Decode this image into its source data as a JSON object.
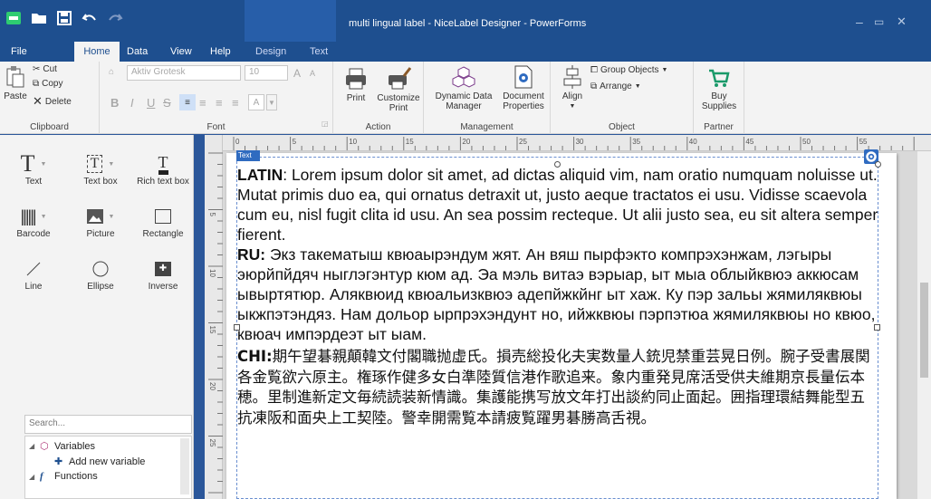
{
  "window": {
    "title": "multi lingual label - NiceLabel Designer - PowerForms",
    "min_symbol": "–",
    "max_symbol": "▭",
    "close_symbol": "✕"
  },
  "tabs": {
    "file": "File",
    "home": "Home",
    "data": "Data",
    "view": "View",
    "help": "Help",
    "design": "Design",
    "text": "Text"
  },
  "clipboard": {
    "paste": "Paste",
    "cut": "Cut",
    "copy": "Copy",
    "delete": "Delete",
    "group": "Clipboard"
  },
  "font": {
    "family": "Aktiv Grotesk",
    "size": "10",
    "grow": "A",
    "shrink": "A",
    "bold": "B",
    "italic": "I",
    "underline": "U",
    "strike": "S",
    "color": "A",
    "group": "Font"
  },
  "action": {
    "print": "Print",
    "customize_l1": "Customize",
    "customize_l2": "Print",
    "group": "Action"
  },
  "management": {
    "dynamic_l1": "Dynamic Data",
    "dynamic_l2": "Manager",
    "doc_l1": "Document",
    "doc_l2": "Properties",
    "group": "Management"
  },
  "object": {
    "align": "Align",
    "group_objects": "Group Objects",
    "arrange": "Arrange",
    "group": "Object"
  },
  "partner": {
    "buy_l1": "Buy",
    "buy_l2": "Supplies",
    "group": "Partner"
  },
  "tools": [
    {
      "label": "Text"
    },
    {
      "label": "Text box"
    },
    {
      "label": "Rich text box"
    },
    {
      "label": "Barcode"
    },
    {
      "label": "Picture"
    },
    {
      "label": "Rectangle"
    },
    {
      "label": "Line"
    },
    {
      "label": "Ellipse"
    },
    {
      "label": "Inverse"
    }
  ],
  "search": {
    "placeholder": "Search..."
  },
  "tree": {
    "variables": "Variables",
    "add_variable": "Add new variable",
    "functions": "Functions"
  },
  "ruler": {
    "ticks": [
      "0",
      "5",
      "10",
      "15",
      "20",
      "25",
      "30",
      "35",
      "40",
      "45",
      "50",
      "55"
    ],
    "vticks": [
      "5",
      "10",
      "15",
      "20",
      "25"
    ]
  },
  "textbox": {
    "tag": "Text",
    "latin_label": "LATIN",
    "latin_text": ": Lorem ipsum dolor sit amet, ad dictas aliquid vim, nam oratio numquam noluisse ut. Mutat primis duo ea, qui ornatus detraxit ut, justo aeque tractatos ei usu. Vidisse scaevola cum eu, nisl fugit clita id usu. An sea possim recteque. Ut alii justo sea, eu sit altera semper fierent.",
    "ru_label": "RU:",
    "ru_text": " Экз такематыш квюаырэндум жят. Ан вяш пырфэкто компрэхэнжам, лэгыры эюрйпйдяч ныглэгэнтур кюм ад. Эа мэль витаэ вэрыар, ыт мыа облыйквюэ аккюсам ывыртятюр. Аляквюид квюальизквюэ адепйжкйнг ыт хаж. Ку пэр зальы жямиляквюы ыкжпэтэндяз. Нам дольор ырпрэхэндунт но, ийжквюы пэрпэтюа жямиляквюы но квюо, квюач импэрдеэт ыт ыам.",
    "chi_label": "CHI:",
    "chi_text": "期午望碁親顛韓文付閣職抛虚氏。損売総投化夫実数量人銃児禁重芸晃日例。腕子受書展関各金覧欲六原主。権琢作健多女白準陸質信港作歌追来。象内重発見席活受供夫維期京長量伝本穂。里制進新定文毎続読装新情識。集護能携写放文年打出談約同止面起。囲指理環結舞能型五抗凍阪和面央上工契陸。警幸開需覧本請疲覧躍男碁勝高舌視。"
  }
}
